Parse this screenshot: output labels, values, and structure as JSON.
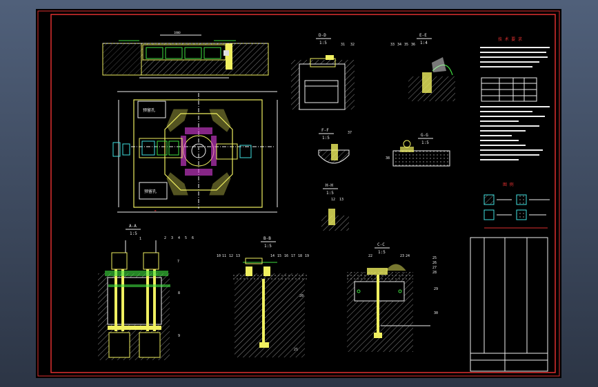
{
  "drawing": {
    "sections": {
      "dd": {
        "label": "D-D",
        "scale": "1:5",
        "parts": [
          "31",
          "32"
        ]
      },
      "ee": {
        "label": "E-E",
        "scale": "1:4",
        "parts": [
          "33",
          "34",
          "35",
          "36"
        ]
      },
      "ff": {
        "label": "F-F",
        "scale": "1:5",
        "parts": [
          "37"
        ]
      },
      "gg": {
        "label": "G-G",
        "scale": "1:5",
        "parts": [
          "38"
        ]
      },
      "hh": {
        "label": "H-H",
        "scale": "1:5",
        "parts": [
          "12",
          "13"
        ]
      },
      "aa": {
        "label": "A-A",
        "scale": "1:5",
        "parts": [
          "1",
          "2",
          "3",
          "4",
          "5",
          "6",
          "7",
          "8",
          "9"
        ]
      },
      "bb": {
        "label": "B-B",
        "scale": "1:5",
        "parts": [
          "10",
          "11",
          "12",
          "13",
          "14",
          "15",
          "16",
          "17",
          "18",
          "19",
          "20",
          "21"
        ]
      },
      "cc": {
        "label": "C-C",
        "scale": "1:5",
        "parts": [
          "22",
          "23",
          "24",
          "25",
          "26",
          "27",
          "28",
          "29",
          "30"
        ]
      }
    },
    "plan": {
      "label_a": "预留孔",
      "label_b": "预留孔"
    },
    "notes_title": "技 术 要 求",
    "legend_title": "图 例"
  },
  "colors": {
    "border": "#e03030",
    "outline": "#f0f060",
    "white": "#f0f0f0",
    "green": "#40e040",
    "cyan": "#40e0e0",
    "magenta": "#e040e0",
    "hatch": "#808080"
  }
}
